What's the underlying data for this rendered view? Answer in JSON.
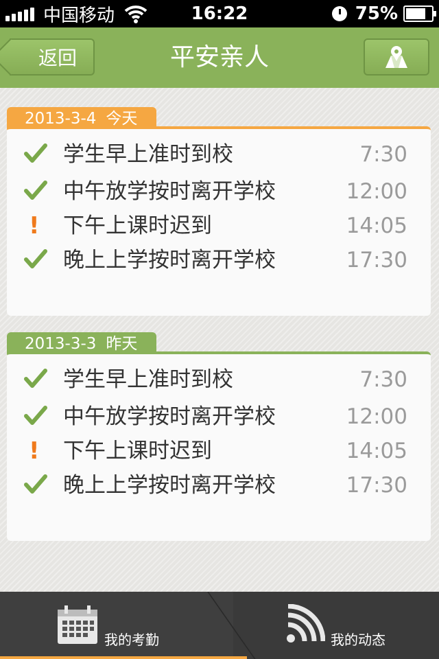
{
  "status_bar": {
    "carrier": "中国移动",
    "time": "16:22",
    "battery": "75%",
    "icons": [
      "signal-icon",
      "wifi-icon",
      "clock-icon",
      "battery-icon"
    ]
  },
  "nav": {
    "back_label": "返回",
    "title": "平安亲人",
    "map_icon": "map-pin-icon"
  },
  "sections": [
    {
      "date": "2013-3-4",
      "day_label": "今天",
      "accent": "#f5a742",
      "records": [
        {
          "status": "ok",
          "text": "学生早上准时到校",
          "time": "7:30"
        },
        {
          "status": "ok",
          "text": "中午放学按时离开学校",
          "time": "12:00"
        },
        {
          "status": "warning",
          "text": "下午上课时迟到",
          "time": "14:05"
        },
        {
          "status": "ok",
          "text": "晚上上学按时离开学校",
          "time": "17:30"
        }
      ]
    },
    {
      "date": "2013-3-3",
      "day_label": "昨天",
      "accent": "#8ab25a",
      "records": [
        {
          "status": "ok",
          "text": "学生早上准时到校",
          "time": "7:30"
        },
        {
          "status": "ok",
          "text": "中午放学按时离开学校",
          "time": "12:00"
        },
        {
          "status": "warning",
          "text": "下午上课时迟到",
          "time": "14:05"
        },
        {
          "status": "ok",
          "text": "晚上上学按时离开学校",
          "time": "17:30"
        }
      ]
    }
  ],
  "tabs": [
    {
      "label": "我的考勤",
      "icon": "calendar-icon",
      "active": true
    },
    {
      "label": "我的动态",
      "icon": "signal-waves-icon",
      "active": false
    }
  ],
  "colors": {
    "nav_green": "#8ab25a",
    "check_green": "#7aa84a",
    "warning_orange": "#ef7a1c",
    "today_orange": "#f5a742"
  }
}
